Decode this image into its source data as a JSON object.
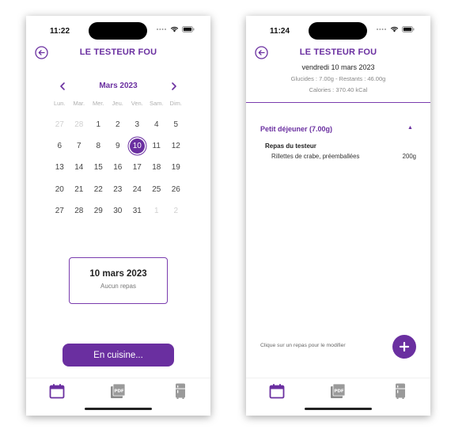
{
  "status": {
    "time_left": "11:22",
    "time_right": "11:24"
  },
  "app": {
    "title": "LE TESTEUR FOU"
  },
  "calendar": {
    "month": "Mars 2023",
    "weekdays": [
      "Lun.",
      "Mar.",
      "Mer.",
      "Jeu.",
      "Ven.",
      "Sam.",
      "Dim."
    ],
    "days": [
      {
        "n": "27",
        "out": true
      },
      {
        "n": "28",
        "out": true
      },
      {
        "n": "1"
      },
      {
        "n": "2"
      },
      {
        "n": "3"
      },
      {
        "n": "4"
      },
      {
        "n": "5"
      },
      {
        "n": "6"
      },
      {
        "n": "7"
      },
      {
        "n": "8"
      },
      {
        "n": "9"
      },
      {
        "n": "10",
        "selected": true
      },
      {
        "n": "11"
      },
      {
        "n": "12"
      },
      {
        "n": "13"
      },
      {
        "n": "14"
      },
      {
        "n": "15"
      },
      {
        "n": "16"
      },
      {
        "n": "17"
      },
      {
        "n": "18"
      },
      {
        "n": "19"
      },
      {
        "n": "20"
      },
      {
        "n": "21"
      },
      {
        "n": "22"
      },
      {
        "n": "23"
      },
      {
        "n": "24"
      },
      {
        "n": "25"
      },
      {
        "n": "26"
      },
      {
        "n": "27"
      },
      {
        "n": "28"
      },
      {
        "n": "29"
      },
      {
        "n": "30"
      },
      {
        "n": "31"
      },
      {
        "n": "1",
        "out": true
      },
      {
        "n": "2",
        "out": true
      }
    ]
  },
  "day_card": {
    "date": "10 mars 2023",
    "subtitle": "Aucun repas"
  },
  "cook_button": "En cuisine...",
  "tabs": {
    "calendar_icon": "calendar-icon",
    "pdf_icon": "pdf-icon",
    "fridge_icon": "fridge-icon"
  },
  "day_view": {
    "date": "vendredi 10 mars 2023",
    "glucides_line": "Glucides : 7.00g - Restants : 46.00g",
    "calories_line": "Calories : 370.40 kCal",
    "meal": {
      "title": "Petit déjeuner (7.00g)",
      "toggle": "▲",
      "name": "Repas du testeur",
      "food": "Rillettes de crabe, préemballées",
      "quantity": "200g"
    },
    "hint": "Clique sur un repas pour le modifier"
  },
  "colors": {
    "accent": "#6a2fa0"
  }
}
